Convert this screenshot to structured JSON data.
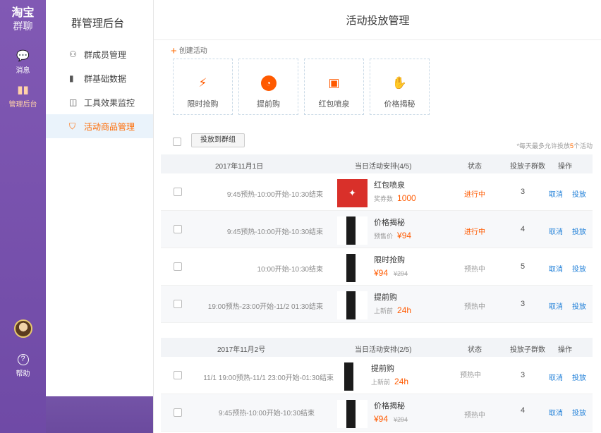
{
  "rail": {
    "brand_line1": "淘宝",
    "brand_line2": "群聊",
    "msg_label": "消息",
    "admin_label": "管理后台",
    "help_label": "帮助"
  },
  "sidebar": {
    "title": "群管理后台",
    "items": [
      {
        "label": "群成员管理",
        "icon": "users-icon"
      },
      {
        "label": "群基础数据",
        "icon": "bar-chart-icon"
      },
      {
        "label": "工具效果监控",
        "icon": "monitor-icon"
      },
      {
        "label": "活动商品管理",
        "icon": "bag-icon"
      }
    ]
  },
  "main": {
    "title": "活动投放管理",
    "create_label": "创建活动",
    "cards": [
      {
        "label": "限时抢购",
        "icon": "lightning-icon"
      },
      {
        "label": "提前购",
        "icon": "clock-icon"
      },
      {
        "label": "红包喷泉",
        "icon": "redpacket-icon"
      },
      {
        "label": "价格揭秘",
        "icon": "hand-icon"
      }
    ],
    "toolbar_button": "投放到群组",
    "note_prefix": "*每天最多允许投放",
    "note_num": "5",
    "note_suffix": "个活动",
    "groups": [
      {
        "date": "2017年11月1日",
        "schedule": "当日活动安排(4/5)",
        "col_status": "状态",
        "col_count": "投放子群数",
        "col_action": "操作",
        "rows": [
          {
            "time": "9:45预热-10:00开始-10:30结束",
            "name": "红包喷泉",
            "sub_label": "奖券数",
            "sub_value": "1000",
            "status": "进行中",
            "count": "3",
            "cancel": "取消",
            "put": "投放"
          },
          {
            "time": "9:45预热-10:00开始-10:30结束",
            "name": "价格揭秘",
            "sub_label": "预售价",
            "sub_value": "¥94",
            "status": "进行中",
            "count": "4",
            "cancel": "取消",
            "put": "投放"
          },
          {
            "time": "10:00开始-10:30结束",
            "name": "限时抢购",
            "price": "¥94",
            "old": "¥294",
            "status": "预热中",
            "count": "5",
            "cancel": "取消",
            "put": "投放"
          },
          {
            "time": "19:00预热-23:00开始-11/2 01:30结束",
            "name": "提前购",
            "sub_label": "上新前",
            "sub_value": "24h",
            "status": "预热中",
            "count": "3",
            "cancel": "取消",
            "put": "投放"
          }
        ]
      },
      {
        "date": "2017年11月2号",
        "schedule": "当日活动安排(2/5)",
        "col_status": "状态",
        "col_count": "投放子群数",
        "col_action": "操作",
        "rows": [
          {
            "time": "11/1 19:00预热-11/1 23:00开始-01:30结束",
            "name": "提前购",
            "sub_label": "上新前",
            "sub_value": "24h",
            "status": "预热中",
            "count": "3",
            "cancel": "取消",
            "put": "投放"
          },
          {
            "time": "9:45预热-10:00开始-10:30结束",
            "name": "价格揭秘",
            "price": "¥94",
            "old": "¥294",
            "status": "预热中",
            "count": "4",
            "cancel": "取消",
            "put": "投放"
          }
        ]
      }
    ]
  },
  "colors": {
    "accent": "#ff5a00",
    "link": "#1f7fd8",
    "rail": "#7650ad"
  }
}
